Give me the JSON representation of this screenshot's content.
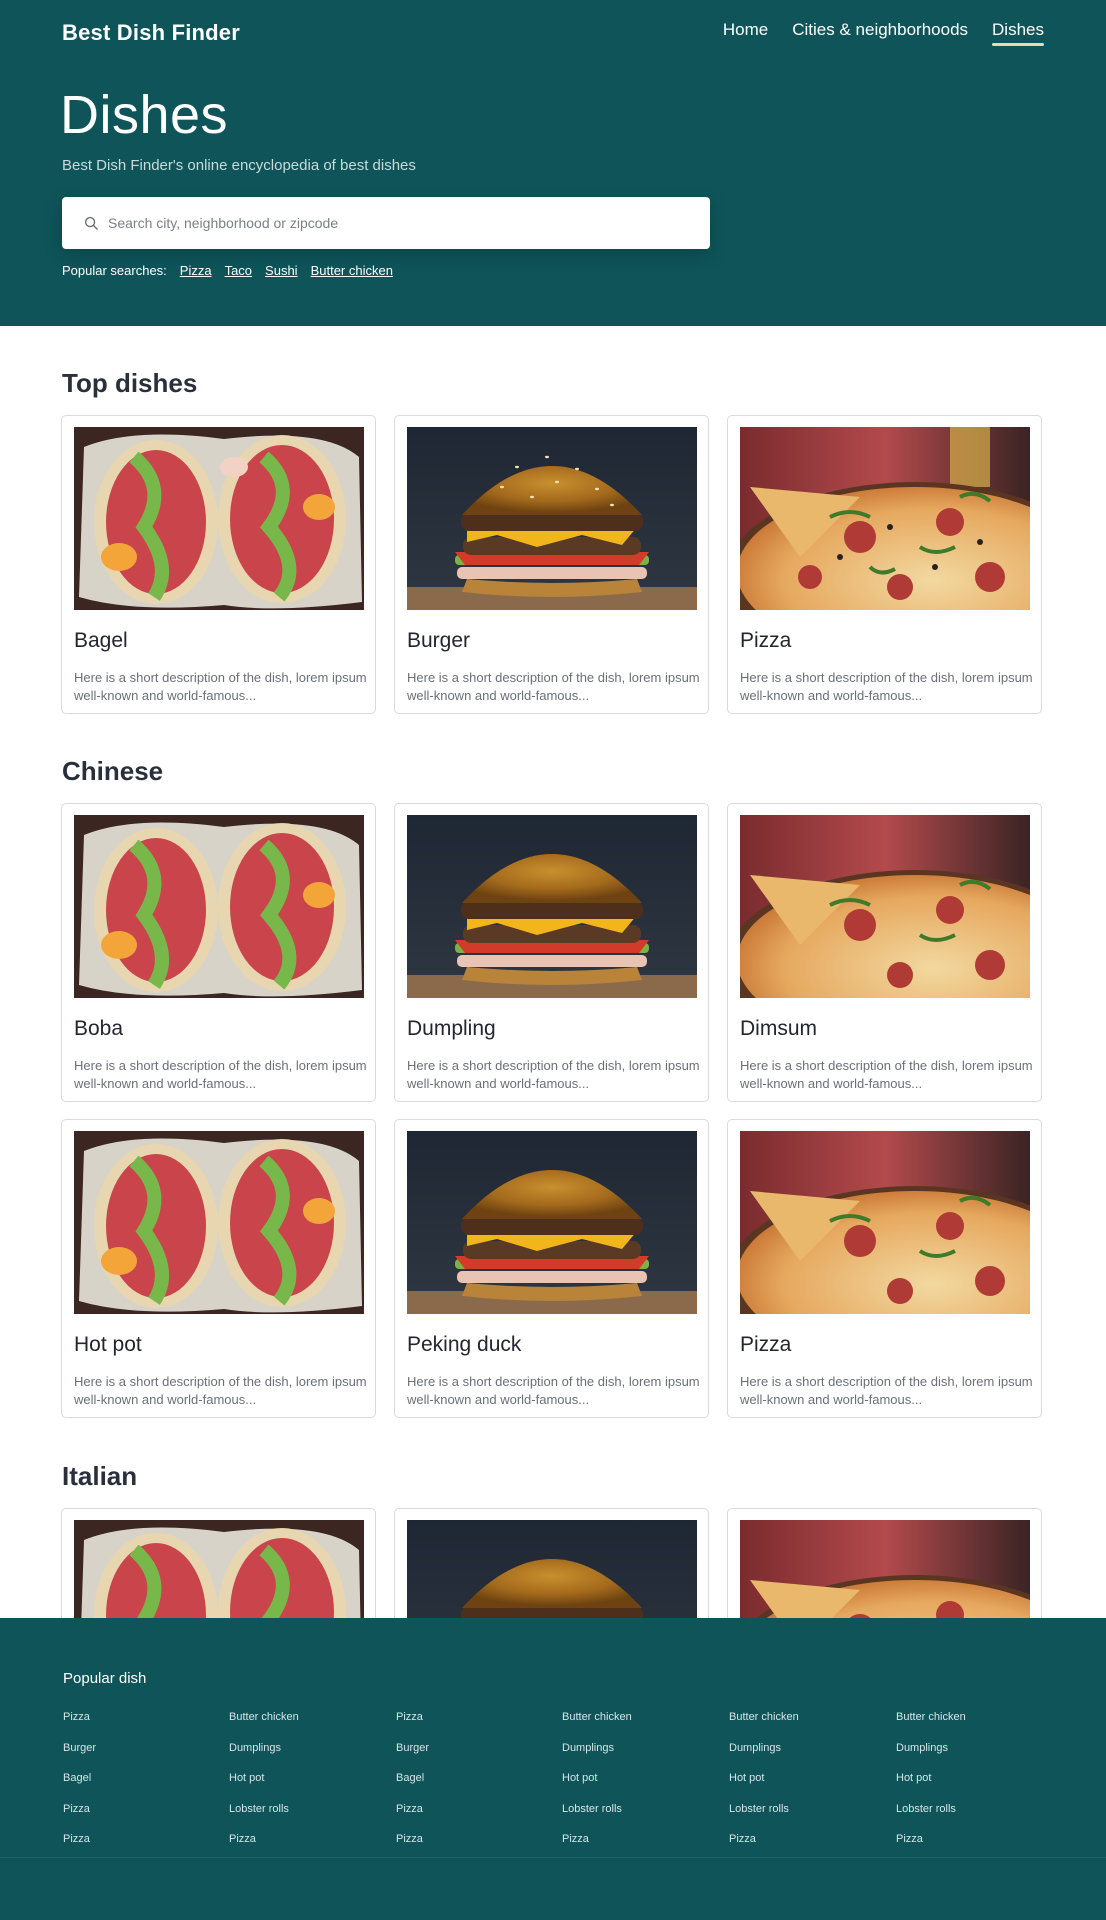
{
  "header": {
    "brand": "Best Dish Finder",
    "nav": [
      {
        "label": "Home"
      },
      {
        "label": "Cities & neighborhoods"
      },
      {
        "label": "Dishes"
      }
    ],
    "title": "Dishes",
    "subtitle": "Best Dish Finder's online encyclopedia of best dishes",
    "search_placeholder": "Search city, neighborhood or zipcode",
    "popular_label": "Popular searches:",
    "popular": [
      "Pizza",
      "Taco",
      "Sushi",
      "Butter chicken"
    ]
  },
  "sections": [
    {
      "title": "Top dishes"
    },
    {
      "title": "Chinese"
    },
    {
      "title": "Italian"
    }
  ],
  "card_description": "Here is a short description of the dish, lorem ipsum well-known and world-famous...",
  "cards": {
    "top": [
      "Bagel",
      "Burger",
      "Pizza"
    ],
    "chinese": [
      "Boba",
      "Dumpling",
      "Dimsum",
      "Hot pot",
      "Peking duck",
      "Pizza"
    ]
  },
  "footer": {
    "heading": "Popular dish",
    "columns": [
      [
        "Pizza",
        "Burger",
        "Bagel",
        "Pizza",
        "Pizza"
      ],
      [
        "Butter chicken",
        "Dumplings",
        "Hot pot",
        "Lobster rolls",
        "Pizza"
      ],
      [
        "Pizza",
        "Burger",
        "Bagel",
        "Pizza",
        "Pizza"
      ],
      [
        "Butter chicken",
        "Dumplings",
        "Hot pot",
        "Lobster rolls",
        "Pizza"
      ],
      [
        "Butter chicken",
        "Dumplings",
        "Hot pot",
        "Lobster rolls",
        "Pizza"
      ],
      [
        "Butter chicken",
        "Dumplings",
        "Hot pot",
        "Lobster rolls",
        "Pizza"
      ]
    ]
  },
  "colors": {
    "header_bg": "#0e5459",
    "accent_underline": "#f1d9a5",
    "heading_text": "#2a2f3c"
  },
  "icons": [
    "search-icon"
  ]
}
